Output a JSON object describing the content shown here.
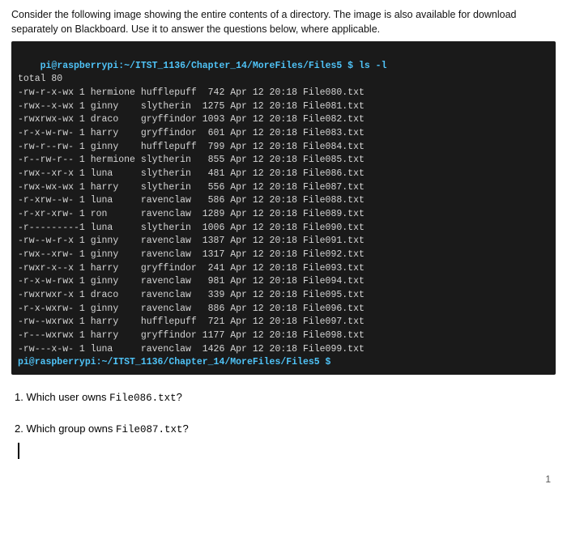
{
  "instructions": {
    "text": "Consider the following image showing the entire contents of a directory.  The image is also available for download separately on Blackboard.  Use it to answer the questions below, where applicable."
  },
  "terminal": {
    "prompt1": "pi@raspberrypi:~/ITST_1136/Chapter_14/MoreFiles/Files5 $ ls -l",
    "lines": [
      "total 80",
      "-rw-r-x-wx 1 hermione hufflepuff  742 Apr 12 20:18 File080.txt",
      "-rwx--x-wx 1 ginny    slytherin 1275 Apr 12 20:18 File081.txt",
      "-rwxrwx-wx 1 draco    gryffindor 1093 Apr 12 20:18 File082.txt",
      "-r-x-w-rw- 1 harry    gryffindor  601 Apr 12 20:18 File083.txt",
      "-rw-r--rw- 1 ginny    hufflepuff  799 Apr 12 20:18 File084.txt",
      "-r--rw-r-- 1 hermione slytherin   855 Apr 12 20:18 File085.txt",
      "-rwx--xr-x 1 luna     slytherin   481 Apr 12 20:18 File086.txt",
      "-rwx-wx-wx 1 harry    slytherin   556 Apr 12 20:18 File087.txt",
      "-r-xrw--w- 1 luna     ravenclaw   586 Apr 12 20:18 File088.txt",
      "-r-xr-xrw- 1 ron      ravenclaw  1289 Apr 12 20:18 File089.txt",
      "-r-------  1 luna     slytherin  1006 Apr 12 20:18 File090.txt",
      "-rw--w-r-x 1 ginny    ravenclaw  1387 Apr 12 20:18 File091.txt",
      "-rwx--xrw- 1 ginny    ravenclaw  1317 Apr 12 20:18 File092.txt",
      "-rwxr-x-x  1 harry    gryffindor  241 Apr 12 20:18 File093.txt",
      "-r-x-w-rwx 1 ginny    ravenclaw   981 Apr 12 20:18 File094.txt",
      "-rwxrwxr-x 1 draco    ravenclaw   339 Apr 12 20:18 File095.txt",
      "-r-x-wxrw- 1 ginny    ravenclaw   886 Apr 12 20:18 File096.txt",
      "-rw--wxrwx 1 harry    hufflepuff  721 Apr 12 20:18 File097.txt",
      "-r---wxrwx 1 harry    gryffindor 1177 Apr 12 20:18 File098.txt",
      "-rw---x-w- 1 luna     ravenclaw  1426 Apr 12 20:18 File099.txt"
    ],
    "prompt2": "pi@raspberrypi:~/ITST_1136/Chapter_14/MoreFiles/Files5 $"
  },
  "questions": [
    {
      "number": "1",
      "text": "Which user owns ",
      "code": "File086.txt",
      "suffix": "?"
    },
    {
      "number": "2",
      "text": "Which group owns ",
      "code": "File087.txt",
      "suffix": "?"
    }
  ],
  "page_number": "1"
}
